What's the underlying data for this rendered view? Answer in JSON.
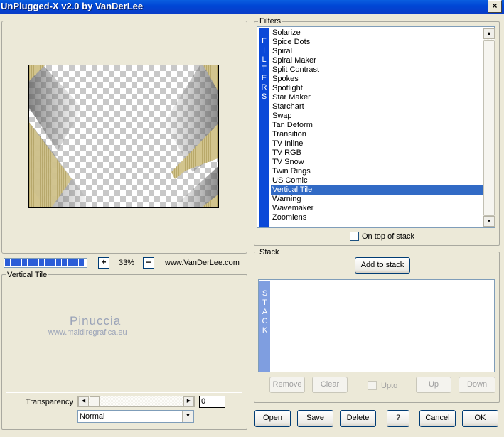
{
  "window": {
    "title": "UnPlugged-X v2.0 by VanDerLee",
    "close_glyph": "×"
  },
  "filters": {
    "group_label": "Filters",
    "band_letters": [
      "F",
      "I",
      "L",
      "T",
      "E",
      "R",
      "S"
    ],
    "items": [
      "Solarize",
      "Spice Dots",
      "Spiral",
      "Spiral Maker",
      "Split Contrast",
      "Spokes",
      "Spotlight",
      "Star Maker",
      "Starchart",
      "Swap",
      "Tan Deform",
      "Transition",
      "TV Inline",
      "TV RGB",
      "TV Snow",
      "Twin Rings",
      "US Comic",
      "Vertical Tile",
      "Warning",
      "Wavemaker",
      "Zoomlens"
    ],
    "selected": "Vertical Tile",
    "on_top_label": "On top of stack",
    "on_top_checked": false
  },
  "stack": {
    "group_label": "Stack",
    "add_label": "Add to stack",
    "band_letters": [
      "S",
      "T",
      "A",
      "C",
      "K"
    ],
    "remove_label": "Remove",
    "clear_label": "Clear",
    "upto_label": "Upto",
    "up_label": "Up",
    "down_label": "Down"
  },
  "preview": {
    "progress_fraction": 1.0,
    "zoom_plus": "+",
    "zoom_minus": "−",
    "zoom_value": "33%",
    "website": "www.VanDerLee.com"
  },
  "params": {
    "group_label": "Vertical Tile",
    "watermark_title": "Pinuccia",
    "watermark_url": "www.maidiregrafica.eu",
    "transparency_label": "Transparency",
    "transparency_value": "0",
    "blend_mode": "Normal"
  },
  "buttons": {
    "open": "Open",
    "save": "Save",
    "delete": "Delete",
    "help": "?",
    "cancel": "Cancel",
    "ok": "OK"
  },
  "colors": {
    "accent": "#0b49d8",
    "selection": "#316ac5",
    "window_bg": "#ece9d8",
    "stack_band": "#7f9ee0"
  }
}
